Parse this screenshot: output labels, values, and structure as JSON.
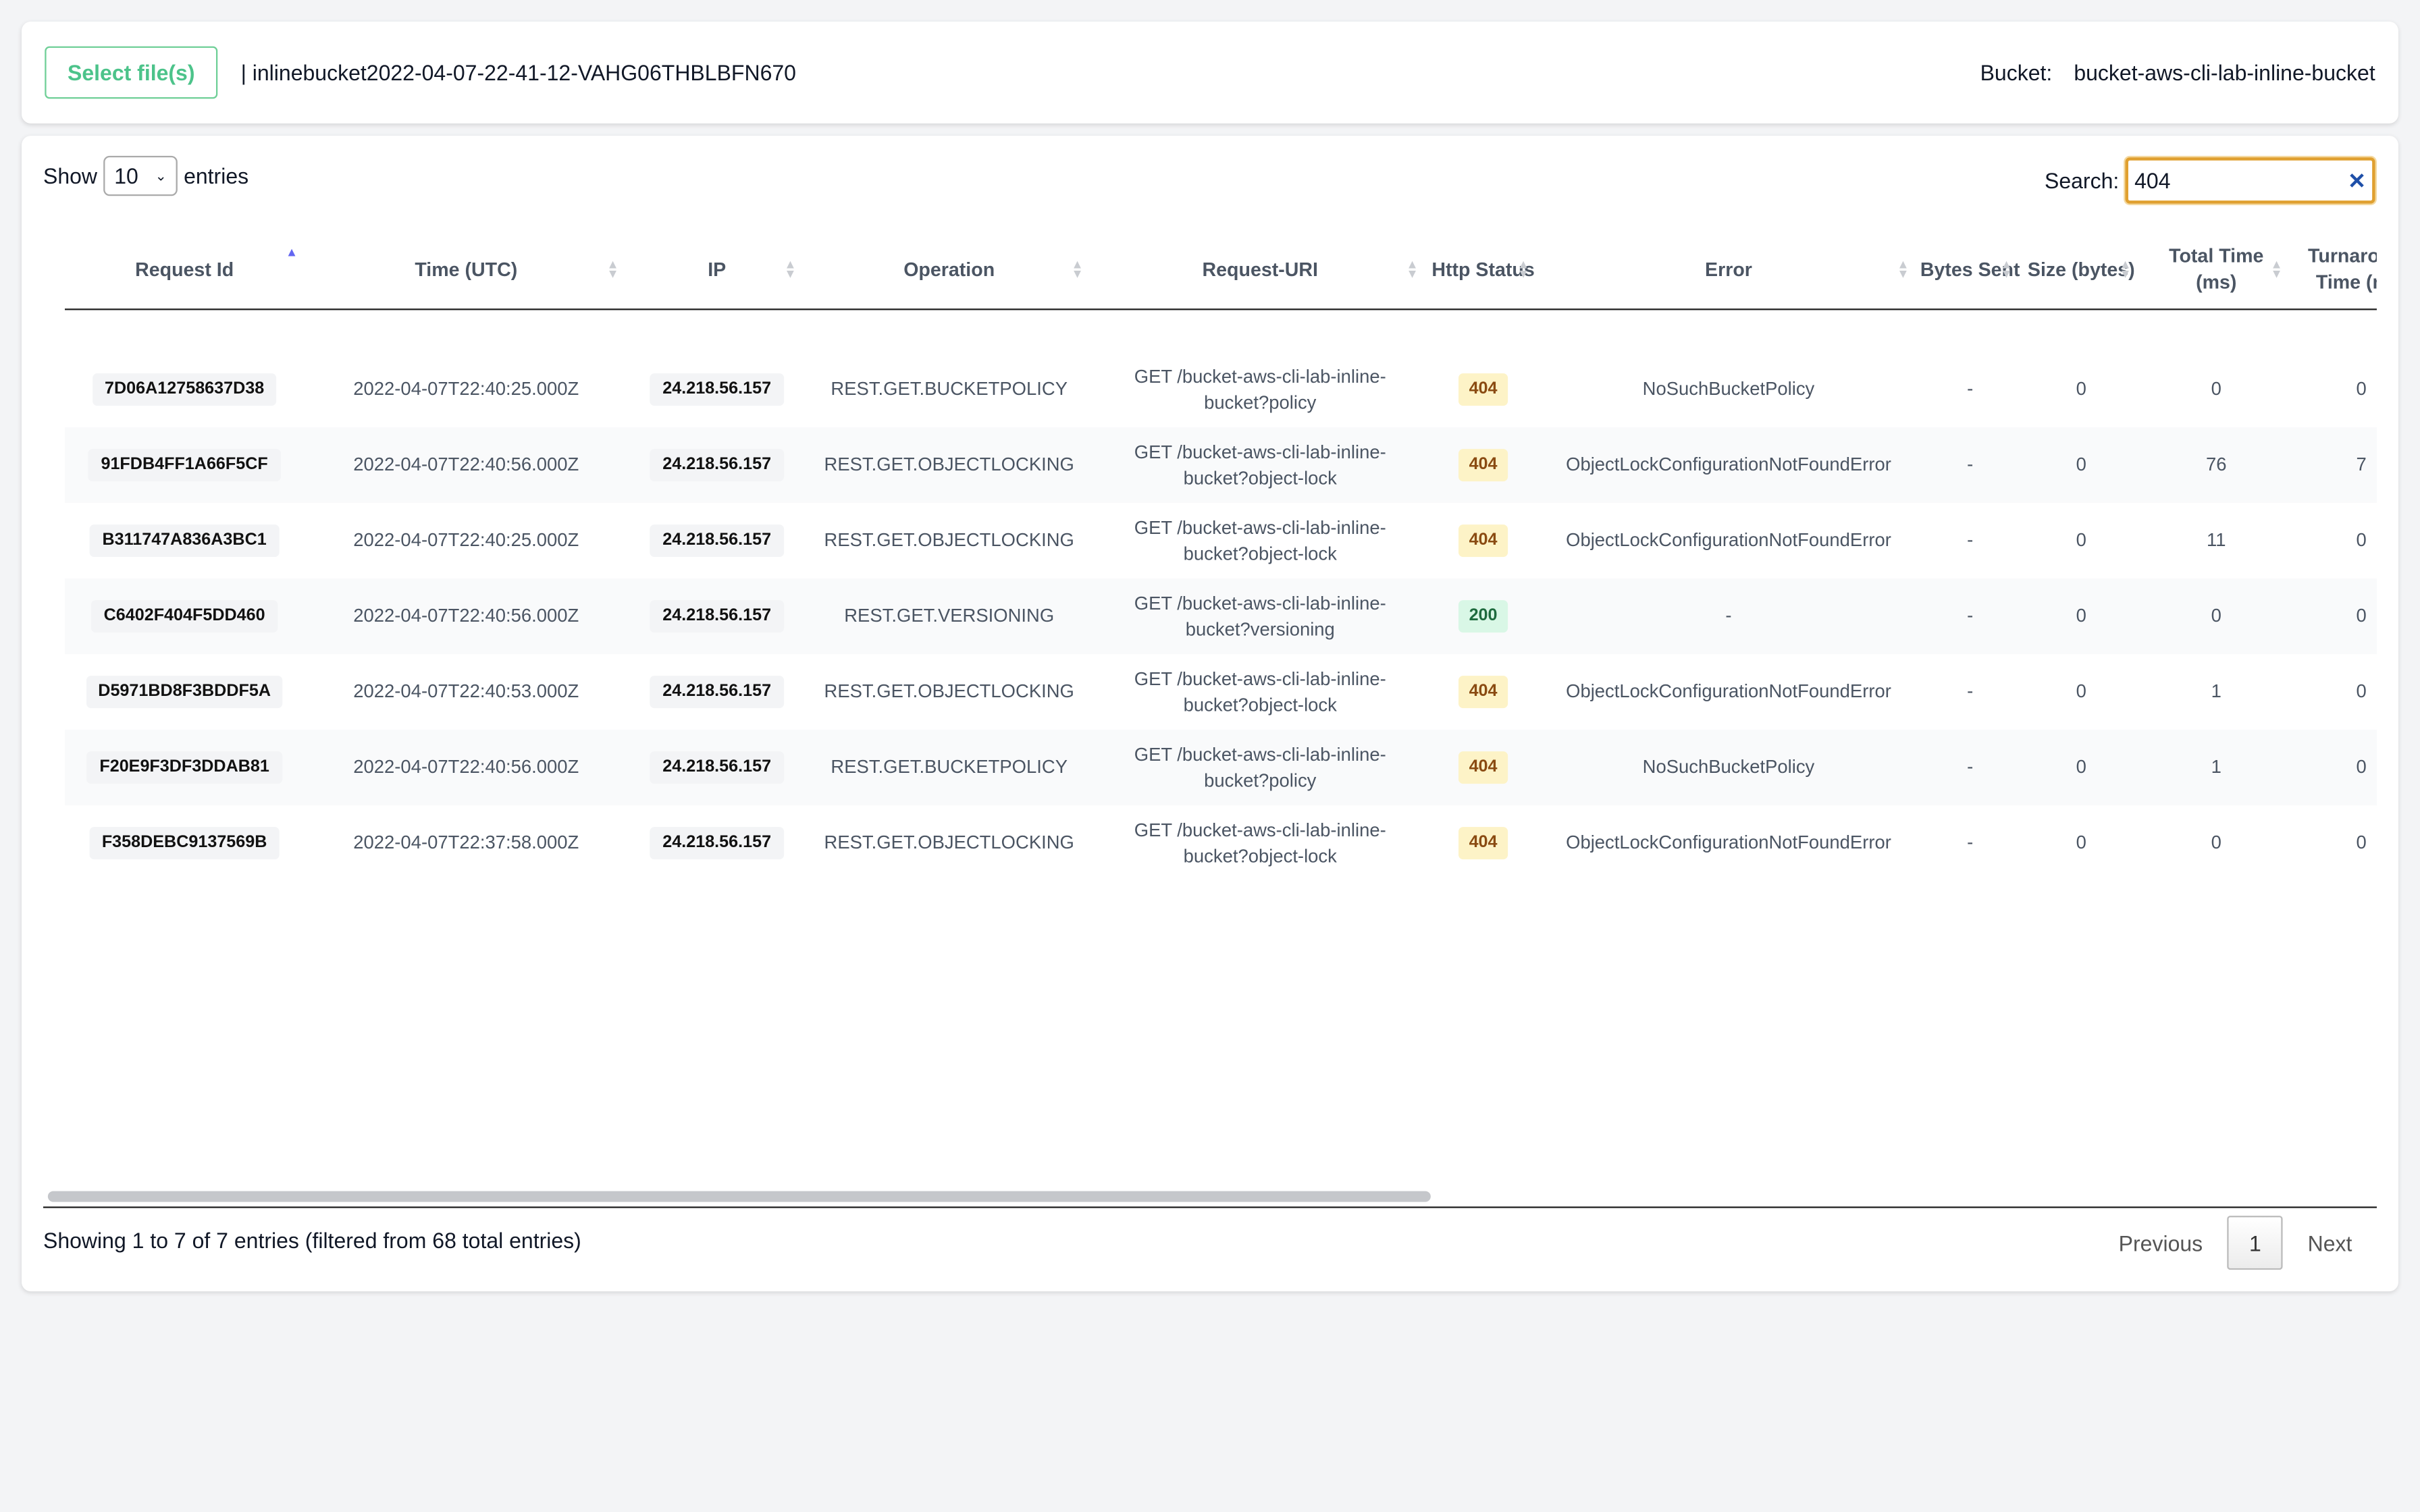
{
  "top": {
    "select_button": "Select file(s)",
    "file_name": "| inlinebucket2022-04-07-22-41-12-VAHG06THBLBFN670",
    "bucket_label": "Bucket:",
    "bucket_value": "bucket-aws-cli-lab-inline-bucket"
  },
  "controls": {
    "show_label": "Show",
    "entries_value": "10",
    "entries_label": "entries",
    "search_label": "Search:",
    "search_value": "404"
  },
  "table": {
    "columns": [
      "Request Id",
      "Time (UTC)",
      "IP",
      "Operation",
      "Request-URI",
      "Http Status",
      "Error",
      "Bytes Sent",
      "Size (bytes)",
      "Total Time (ms)",
      "Turnaround Time (ms)"
    ],
    "sorted_column": "Request Id",
    "sort_direction": "ascending",
    "rows": [
      [
        "7D06A12758637D38",
        "2022-04-07T22:40:25.000Z",
        "24.218.56.157",
        "REST.GET.BUCKETPOLICY",
        "GET /bucket-aws-cli-lab-inline-bucket?policy",
        "404",
        "NoSuchBucketPolicy",
        "-",
        "0",
        "0",
        "0"
      ],
      [
        "91FDB4FF1A66F5CF",
        "2022-04-07T22:40:56.000Z",
        "24.218.56.157",
        "REST.GET.OBJECTLOCKING",
        "GET /bucket-aws-cli-lab-inline-bucket?object-lock",
        "404",
        "ObjectLockConfigurationNotFoundError",
        "-",
        "0",
        "76",
        "7"
      ],
      [
        "B311747A836A3BC1",
        "2022-04-07T22:40:25.000Z",
        "24.218.56.157",
        "REST.GET.OBJECTLOCKING",
        "GET /bucket-aws-cli-lab-inline-bucket?object-lock",
        "404",
        "ObjectLockConfigurationNotFoundError",
        "-",
        "0",
        "11",
        "0"
      ],
      [
        "C6402F404F5DD460",
        "2022-04-07T22:40:56.000Z",
        "24.218.56.157",
        "REST.GET.VERSIONING",
        "GET /bucket-aws-cli-lab-inline-bucket?versioning",
        "200",
        "-",
        "-",
        "0",
        "0",
        "0"
      ],
      [
        "D5971BD8F3BDDF5A",
        "2022-04-07T22:40:53.000Z",
        "24.218.56.157",
        "REST.GET.OBJECTLOCKING",
        "GET /bucket-aws-cli-lab-inline-bucket?object-lock",
        "404",
        "ObjectLockConfigurationNotFoundError",
        "-",
        "0",
        "1",
        "0"
      ],
      [
        "F20E9F3DF3DDAB81",
        "2022-04-07T22:40:56.000Z",
        "24.218.56.157",
        "REST.GET.BUCKETPOLICY",
        "GET /bucket-aws-cli-lab-inline-bucket?policy",
        "404",
        "NoSuchBucketPolicy",
        "-",
        "0",
        "1",
        "0"
      ],
      [
        "F358DEBC9137569B",
        "2022-04-07T22:37:58.000Z",
        "24.218.56.157",
        "REST.GET.OBJECTLOCKING",
        "GET /bucket-aws-cli-lab-inline-bucket?object-lock",
        "404",
        "ObjectLockConfigurationNotFoundError",
        "-",
        "0",
        "0",
        "0"
      ]
    ]
  },
  "footer": {
    "info": "Showing 1 to 7 of 7 entries (filtered from 68 total entries)",
    "previous": "Previous",
    "page": "1",
    "next": "Next"
  },
  "colors": {
    "accent_green": "#4cc38a",
    "status_404_bg": "#fdf3c7",
    "status_200_bg": "#d9f7e6",
    "search_focus": "#e0a030"
  }
}
